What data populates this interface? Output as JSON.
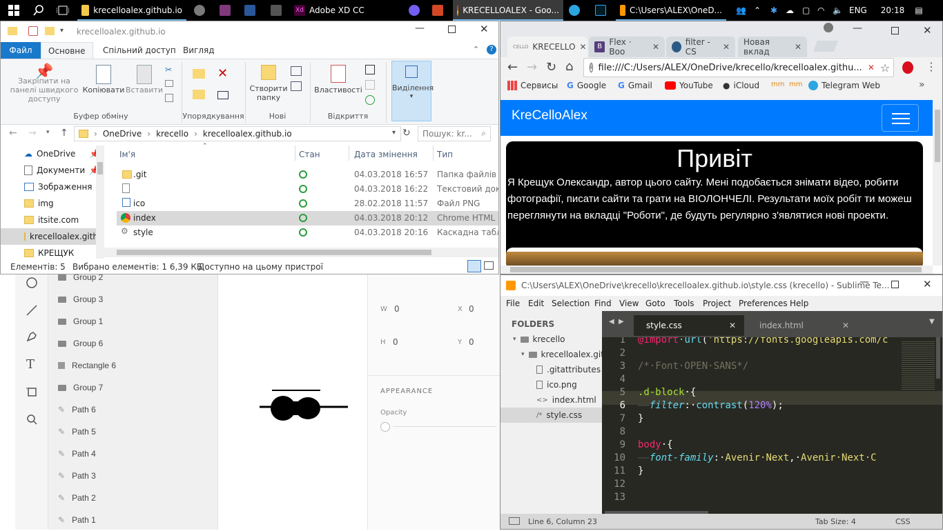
{
  "taskbar": {
    "apps": [
      {
        "label": "krecelloalex.github.io",
        "active": false
      },
      {
        "label": "Adobe XD CC",
        "active": false
      },
      {
        "label": "KRECELLOALEX - Goo...",
        "active": true
      },
      {
        "label": "C:\\Users\\ALEX\\OneD...",
        "active": false
      }
    ],
    "lang": "ENG",
    "time": "20:18"
  },
  "xd": {
    "layers": [
      "Group 2",
      "Group 3",
      "Group 1",
      "Group 6",
      "Rectangle 6",
      "Group 7",
      "Path 6",
      "Path 5",
      "Path 4",
      "Path 3",
      "Path 2",
      "Path 1"
    ],
    "props": {
      "w_label": "W",
      "w_value": "0",
      "x_label": "X",
      "x_value": "0",
      "h_label": "H",
      "h_value": "0",
      "y_label": "Y",
      "y_value": "0",
      "appearance": "APPEARANCE",
      "opacity": "Opacity"
    }
  },
  "explorer": {
    "title": "krecelloalex.github.io",
    "tabs": [
      "Файл",
      "Основне",
      "Спільний доступ",
      "Вигляд"
    ],
    "ribbon": {
      "pin": "Закріпити на панелі швидкого доступу",
      "copy": "Копіювати",
      "paste": "Вставити",
      "new_folder": "Створити папку",
      "properties": "Властивості",
      "select": "Виділення",
      "groups": [
        "Буфер обміну",
        "Упорядкування",
        "Нові",
        "Відкриття"
      ]
    },
    "breadcrumb": [
      "OneDrive",
      "krecello",
      "krecelloalex.github.io"
    ],
    "search_placeholder": "Пошук: kr...",
    "nav": [
      "OneDrive",
      "Документи",
      "Зображення",
      "img",
      "itsite.com",
      "krecelloalex.githu",
      "КРЕЩУК"
    ],
    "columns": [
      "Ім'я",
      "Стан",
      "Дата змінення",
      "Тип"
    ],
    "files": [
      {
        "name": ".git",
        "date": "04.03.2018 16:57",
        "type": "Папка файлів"
      },
      {
        "name": "",
        "date": "04.03.2018 16:22",
        "type": "Текстовий докум"
      },
      {
        "name": "ico",
        "date": "28.02.2018 11:57",
        "type": "Файл PNG"
      },
      {
        "name": "index",
        "date": "04.03.2018 20:12",
        "type": "Chrome HTML D"
      },
      {
        "name": "style",
        "date": "04.03.2018 20:16",
        "type": "Каскадна таблиц"
      }
    ],
    "status": {
      "count": "Елементів: 5",
      "selected": "Вибрано елементів: 1  6,39 КБ",
      "available": "Доступно на цьому пристрої"
    }
  },
  "chrome": {
    "tabs": [
      "KRECELLO",
      "Flex · Boo",
      "filter - CS",
      "Новая вклад"
    ],
    "url": "file:///C:/Users/ALEX/OneDrive/krecello/krecelloalex.githu...",
    "bookmarks": [
      "Сервисы",
      "Google",
      "Gmail",
      "YouTube",
      "iCloud",
      "",
      "",
      "Telegram Web"
    ],
    "site": {
      "brand": "KreCelloAlex",
      "heading": "Привіт",
      "text": "Я Крещук Олександр, автор цього сайту. Мені подобається знімати відео, робити фотографії, писати сайти та грати на ВІОЛОНЧЕЛІ. Результати моїх робіт ти можеш переглянути на вкладці \"Роботи\", де будуть регулярно з'являтися нові проекти."
    }
  },
  "sublime": {
    "title": "C:\\Users\\ALEX\\OneDrive\\krecello\\krecelloalex.github.io\\style.css (krecello) - Sublime Te...",
    "menu": [
      "File",
      "Edit",
      "Selection",
      "Find",
      "View",
      "Goto",
      "Tools",
      "Project",
      "Preferences",
      "Help"
    ],
    "folders_label": "FOLDERS",
    "tree": [
      "krecello",
      "krecelloalex.gith",
      ".gitattributes",
      "ico.png",
      "index.html",
      "style.css"
    ],
    "tabs": [
      "style.css",
      "index.html"
    ],
    "lines": [
      "1",
      "2",
      "3",
      "4",
      "5",
      "6",
      "7",
      "8",
      "9",
      "10",
      "11",
      "12",
      "13"
    ],
    "status": {
      "pos": "Line 6, Column 23",
      "tab": "Tab Size: 4",
      "syntax": "CSS"
    }
  }
}
